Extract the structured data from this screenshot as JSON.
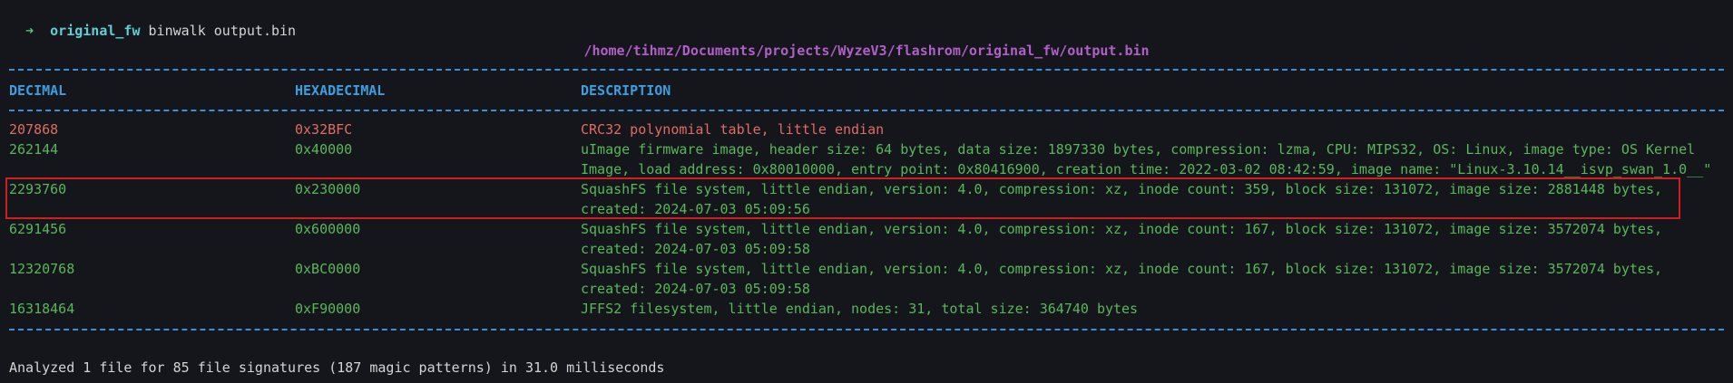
{
  "prompt": {
    "arrow": "➜",
    "cwd": "original_fw",
    "command": "binwalk output.bin"
  },
  "file_path": "/home/tihmz/Documents/projects/WyzeV3/flashrom/original_fw/output.bin",
  "headers": {
    "decimal": "DECIMAL",
    "hexadecimal": "HEXADECIMAL",
    "description": "DESCRIPTION"
  },
  "rows": [
    {
      "decimal": "207868",
      "hex": "0x32BFC",
      "description": "CRC32 polynomial table, little endian",
      "status": "error"
    },
    {
      "decimal": "262144",
      "hex": "0x40000",
      "description_lines": [
        "uImage firmware image, header size: 64 bytes, data size: 1897330 bytes, compression: lzma, CPU: MIPS32, OS: Linux, image type: OS Kernel",
        "Image, load address: 0x80010000, entry point: 0x80416900, creation time: 2022-03-02 08:42:59, image name: \"Linux-3.10.14__isvp_swan_1.0__\""
      ],
      "status": "ok"
    },
    {
      "decimal": "2293760",
      "hex": "0x230000",
      "description_lines": [
        "SquashFS file system, little endian, version: 4.0, compression: xz, inode count: 359, block size: 131072, image size: 2881448 bytes,",
        "created: 2024-07-03 05:09:56"
      ],
      "status": "ok",
      "highlighted": true
    },
    {
      "decimal": "6291456",
      "hex": "0x600000",
      "description_lines": [
        "SquashFS file system, little endian, version: 4.0, compression: xz, inode count: 167, block size: 131072, image size: 3572074 bytes,",
        "created: 2024-07-03 05:09:58"
      ],
      "status": "ok"
    },
    {
      "decimal": "12320768",
      "hex": "0xBC0000",
      "description_lines": [
        "SquashFS file system, little endian, version: 4.0, compression: xz, inode count: 167, block size: 131072, image size: 3572074 bytes,",
        "created: 2024-07-03 05:09:58"
      ],
      "status": "ok"
    },
    {
      "decimal": "16318464",
      "hex": "0xF90000",
      "description": "JFFS2 filesystem, little endian, nodes: 31, total size: 364740 bytes",
      "status": "ok"
    }
  ],
  "footer": "Analyzed 1 file for 85 file signatures (187 magic patterns) in 31.0 milliseconds",
  "colors": {
    "background": "#14161b",
    "error": "#e06c63",
    "ok": "#57b85a",
    "header": "#3a9fe0",
    "path": "#b15fc8",
    "highlight_box": "#d11f1f"
  }
}
